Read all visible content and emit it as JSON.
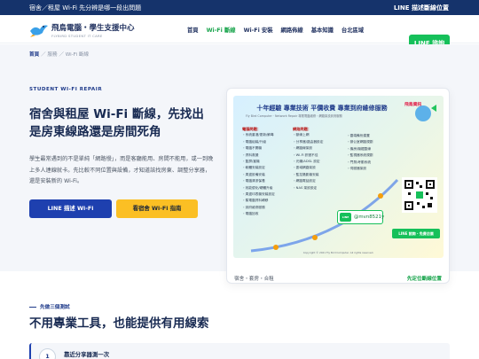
{
  "topbar": {
    "left_text": "宿舍／租屋 Wi-Fi 先分辨是哪一段出問題",
    "right_link": "LINE 描述斷線位置"
  },
  "header": {
    "brand_name": "飛鳥電腦・學生支援中心",
    "brand_sub": "FLYBIRD STUDENT IT CARE",
    "nav": [
      "首頁",
      "Wi-Fi 斷線",
      "Wi-Fi 安裝",
      "網路佈線",
      "基本知識",
      "台北區域"
    ],
    "cta": "LINE 諮詢"
  },
  "breadcrumb": {
    "home": "首頁",
    "rest": " ／ 服務 ／ Wi-Fi 斷線"
  },
  "hero": {
    "eyebrow": "STUDENT WI-FI REPAIR",
    "title": "宿舍與租屋 Wi-Fi 斷線，先找出是房東線路還是房間死角",
    "description": "學生最常遇到的不是單純「網路慢」，而是客廳能用、房間不能用，或一到晚上多人連線就卡。先比較不同位置與設備，才知道該找房東、調整分享器，還是安裝新的 Wi-Fi。",
    "primary_button": "LINE 描述 Wi-Fi",
    "secondary_button": "看宿舍 Wi-Fi 指南"
  },
  "card": {
    "flyer_title": "十年經驗 專業技術 平價收費 專業到府維修服務",
    "flyer_sub": "Fly Bird Computer · Network Repair 專業電腦維修・網路架設到府服務",
    "flyer_brand": "飛鳥資訊",
    "col_a_head": "電腦問題：",
    "col_a": [
      "・系統重灌/更新/解毒",
      "・電腦組裝/升級",
      "・電腦不開機",
      "・資料救援",
      "・藍屏/當機",
      "・軟體安裝設定",
      "・周邊設備安裝",
      "・電腦清潔保養",
      "・效能優化/硬體升級",
      "・周邊印表機安裝設定",
      "・舊電腦資料轉移",
      "・到府維修服務",
      "・電腦回收"
    ],
    "col_b_head": "網路問題：",
    "col_b": [
      "・斷線上網",
      "・分享器/路由器設定",
      "・網路線架設",
      "・Wi-Fi 訊號不佳",
      "・光纖/ADSL 設定",
      "・區域網路架設",
      "・監控攝影機安裝",
      "・網路電話設定",
      "・NAS 架設設定"
    ],
    "col_c": [
      "・雲端備份建置",
      "・辦公室網路規劃",
      "・機房/機櫃整線",
      "・監視器系統規劃",
      "・門禁/考勤系統",
      "・伺服器架設"
    ],
    "line_id": "@mvn8521y",
    "qr_caption": "LINE 諮詢・免費估價",
    "copyright": "Copyright © 2021 Fly Bird Computer. All rights reserved.",
    "foot_left": "宿舍・套房・合租",
    "foot_right": "先定位斷線位置"
  },
  "section2": {
    "eyebrow": "先做三個測試",
    "title": "不用專業工具，也能提供有用線索",
    "steps": [
      {
        "num": "1",
        "title": "靠近分享器測一次"
      }
    ]
  }
}
